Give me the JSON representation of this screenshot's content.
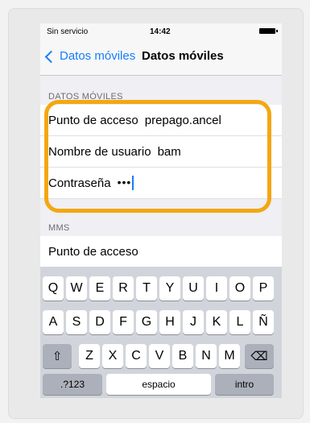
{
  "status": {
    "carrier": "Sin servicio",
    "time": "14:42"
  },
  "nav": {
    "back_label": "Datos móviles",
    "title": "Datos móviles"
  },
  "section1": {
    "header": "DATOS MÓVILES",
    "rows": [
      {
        "label": "Punto de acceso",
        "value": "prepago.ancel"
      },
      {
        "label": "Nombre de usuario",
        "value": "bam"
      },
      {
        "label": "Contraseña",
        "value": "•••"
      }
    ]
  },
  "section2": {
    "header": "MMS",
    "rows": [
      {
        "label": "Punto de acceso",
        "value": ""
      }
    ]
  },
  "keyboard": {
    "row1": [
      "Q",
      "W",
      "E",
      "R",
      "T",
      "Y",
      "U",
      "I",
      "O",
      "P"
    ],
    "row2": [
      "A",
      "S",
      "D",
      "F",
      "G",
      "H",
      "J",
      "K",
      "L",
      "Ñ"
    ],
    "row3": [
      "Z",
      "X",
      "C",
      "V",
      "B",
      "N",
      "M"
    ],
    "shift": "⇧",
    "backspace": "⌫",
    "num": ".?123",
    "space": "espacio",
    "enter": "intro"
  },
  "colors": {
    "accent": "#147efb",
    "highlight": "#f3a712"
  }
}
